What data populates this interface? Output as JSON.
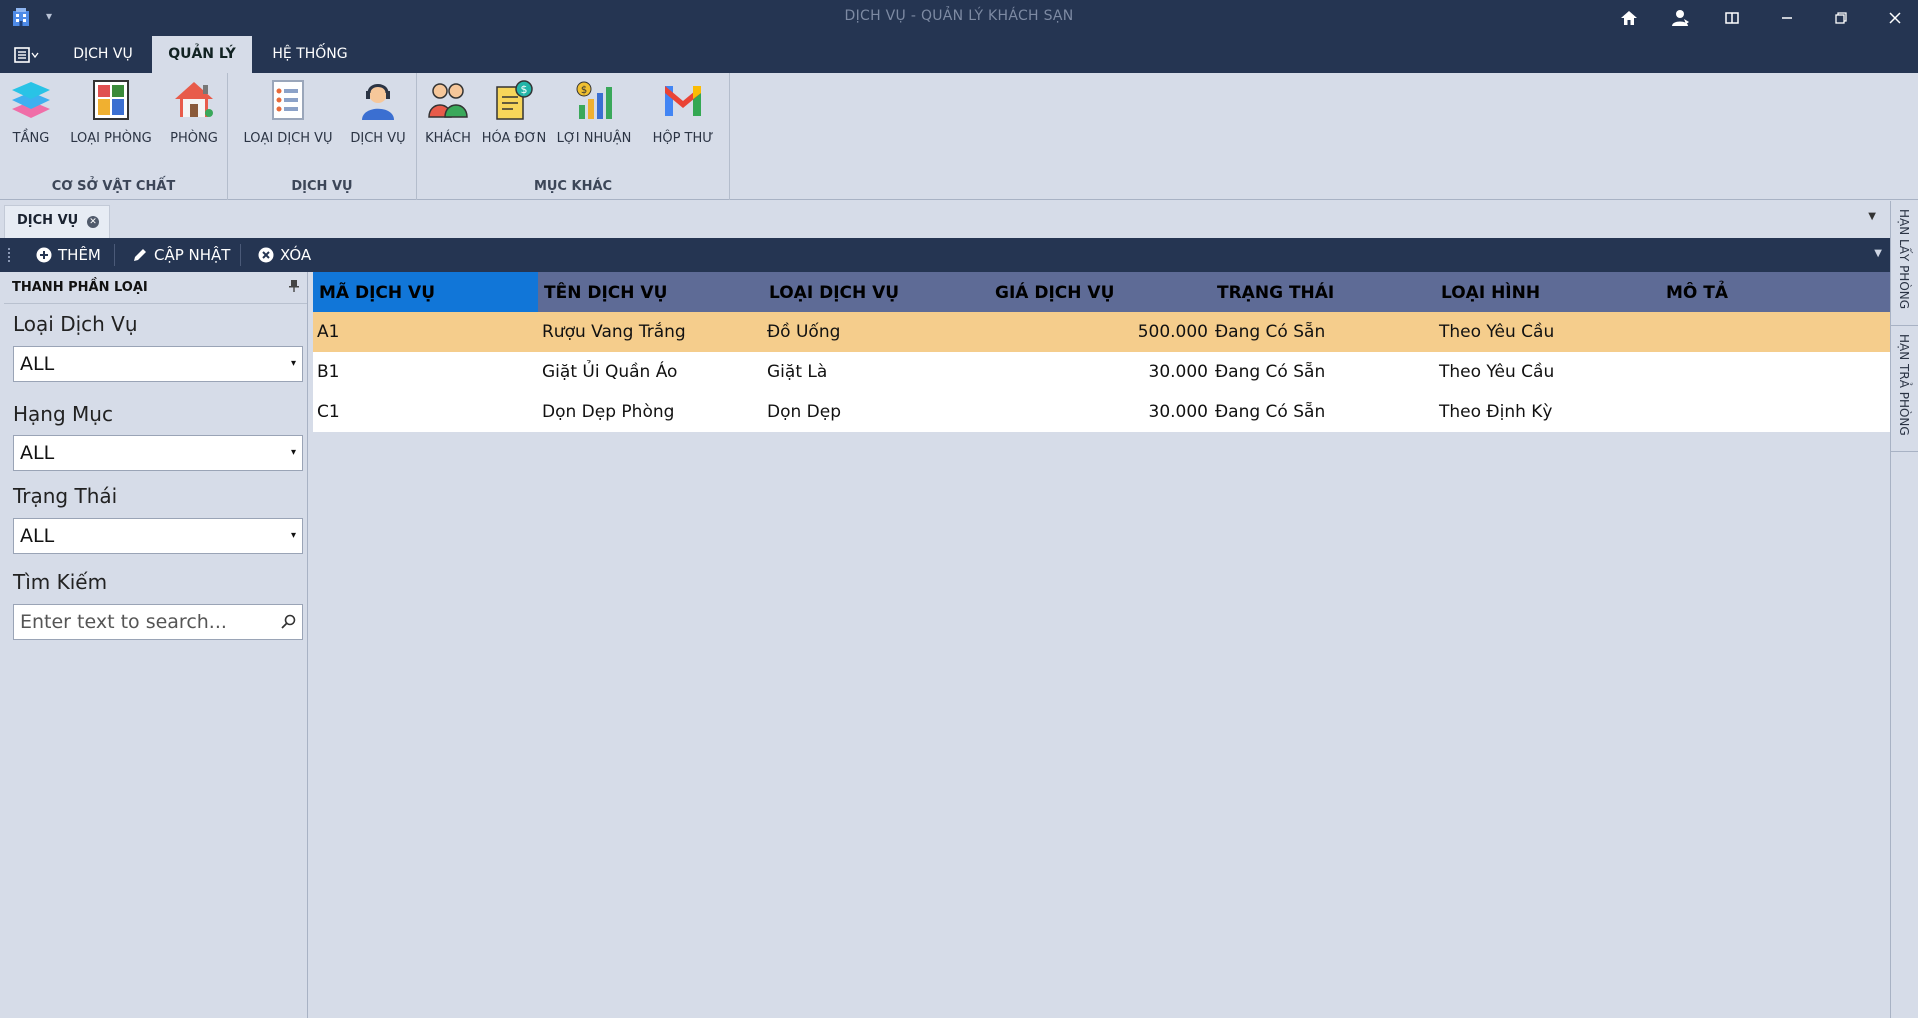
{
  "window": {
    "title": "DỊCH VỤ - QUẢN LÝ KHÁCH SẠN",
    "qat_arrow": "▾"
  },
  "ribbon_tabs": [
    {
      "label": "DỊCH VỤ"
    },
    {
      "label": "QUẢN LÝ"
    },
    {
      "label": "HỆ THỐNG"
    }
  ],
  "groups": {
    "co_so": {
      "title": "CƠ SỞ VẬT CHẤT",
      "buttons": [
        {
          "label": "TẦNG"
        },
        {
          "label": "LOẠI PHÒNG"
        },
        {
          "label": "PHÒNG"
        }
      ]
    },
    "dich_vu": {
      "title": "DỊCH VỤ",
      "buttons": [
        {
          "label": "LOẠI DỊCH VỤ"
        },
        {
          "label": "DỊCH VỤ"
        }
      ]
    },
    "muc_khac": {
      "title": "MỤC KHÁC",
      "buttons": [
        {
          "label": "KHÁCH"
        },
        {
          "label": "HÓA ĐƠN"
        },
        {
          "label": "LỢI NHUẬN"
        },
        {
          "label": "HỘP THƯ"
        }
      ]
    }
  },
  "doc_tab": {
    "label": "DỊCH VỤ"
  },
  "toolbar": {
    "add": "THÊM",
    "update": "CẬP NHẬT",
    "delete": "XÓA"
  },
  "side_panel": {
    "title": "THANH PHẦN LOẠI",
    "loai_label": "Loại Dịch Vụ",
    "loai_value": "ALL",
    "hang_muc_label": "Hạng Mục",
    "hang_muc_value": "ALL",
    "trang_thai_label": "Trạng Thái",
    "trang_thai_value": "ALL",
    "tim_kiem_label": "Tìm Kiếm",
    "search_placeholder": "Enter text to search..."
  },
  "grid": {
    "columns": [
      "MÃ DỊCH VỤ",
      "TÊN DỊCH VỤ",
      "LOẠI DỊCH VỤ",
      "GIÁ DỊCH VỤ",
      "TRẠNG THÁI",
      "LOẠI HÌNH",
      "MÔ TẢ"
    ],
    "rows": [
      {
        "ma": "A1",
        "ten": "Rượu Vang Trắng",
        "loai": "Đồ Uống",
        "gia": "500.000",
        "trang_thai": "Đang Có Sẵn",
        "loai_hinh": "Theo Yêu Cầu",
        "mo_ta": ""
      },
      {
        "ma": "B1",
        "ten": "Giặt Ủi Quần Áo",
        "loai": "Giặt Là",
        "gia": "30.000",
        "trang_thai": "Đang Có Sẵn",
        "loai_hinh": "Theo Yêu Cầu",
        "mo_ta": ""
      },
      {
        "ma": "C1",
        "ten": "Dọn Dẹp Phòng",
        "loai": "Dọn Dẹp",
        "gia": "30.000",
        "trang_thai": "Đang Có Sẵn",
        "loai_hinh": "Theo Định Kỳ",
        "mo_ta": ""
      }
    ]
  },
  "right_dock": {
    "tab1": "HẠN LẤY PHÒNG",
    "tab2": "HẠN TRẢ PHÒNG"
  },
  "colors": {
    "titlebar": "#253552",
    "ribbon": "#d6dce8",
    "grid_header": "#5e6b96",
    "selected_header": "#1176d8",
    "selected_row": "#f5cd8c"
  }
}
